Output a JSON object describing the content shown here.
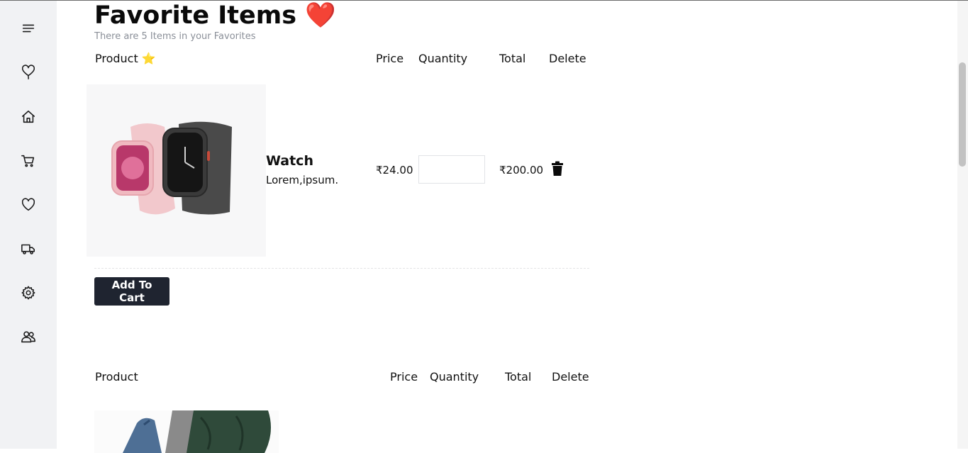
{
  "sidebar": {
    "items": [
      {
        "icon": "menu-icon"
      },
      {
        "icon": "balloon-heart-icon"
      },
      {
        "icon": "home-icon"
      },
      {
        "icon": "cart-icon"
      },
      {
        "icon": "heart-icon"
      },
      {
        "icon": "truck-icon"
      },
      {
        "icon": "gear-icon"
      },
      {
        "icon": "users-icon"
      }
    ]
  },
  "header": {
    "title": "Favorite Items ❤️",
    "subtitle": "There are 5 Items in your Favorites"
  },
  "favorites": [
    {
      "headers": {
        "product": "Product ⭐",
        "price": "Price",
        "quantity": "Quantity",
        "total": "Total",
        "delete": "Delete"
      },
      "name": "Watch",
      "description": "Lorem,ipsum.",
      "price": "₹24.00",
      "quantity": "",
      "total": "₹200.00",
      "image": "smartwatch-image",
      "add_to_cart_label": "Add To Cart"
    },
    {
      "headers": {
        "product": "Product",
        "price": "Price",
        "quantity": "Quantity",
        "total": "Total",
        "delete": "Delete"
      },
      "image": "clothing-image"
    }
  ],
  "colors": {
    "sidebar_bg": "#f1f2f4",
    "button_bg": "#1f2430",
    "subtitle": "#8a8f98"
  }
}
